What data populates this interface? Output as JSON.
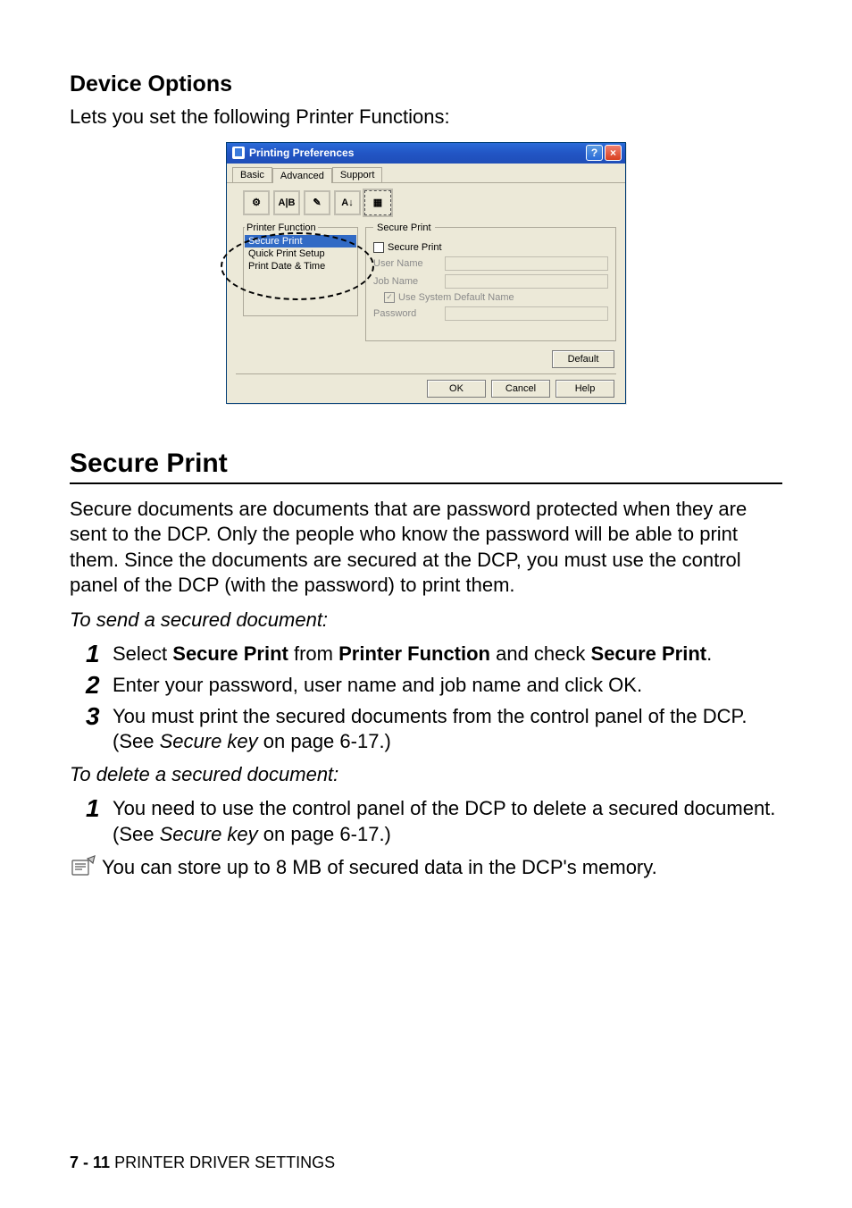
{
  "headings": {
    "device_options": "Device Options",
    "secure_print": "Secure Print"
  },
  "intro_text": "Lets you set the following Printer Functions:",
  "dialog": {
    "title": "Printing Preferences",
    "help_glyph": "?",
    "close_glyph": "×",
    "tabs": {
      "basic": "Basic",
      "advanced": "Advanced",
      "support": "Support"
    },
    "toolbar_icons": {
      "opt1": "⚙",
      "opt2": "A|B",
      "opt3": "✎",
      "opt4": "A↓",
      "opt5": "▦"
    },
    "printer_function_label": "Printer Function",
    "printer_functions": {
      "secure_print": "Secure Print",
      "quick_print_setup": "Quick Print Setup",
      "print_date_time": "Print Date & Time"
    },
    "secure_group_label": "Secure Print",
    "secure_print_checkbox": "Secure Print",
    "user_name_label": "User Name",
    "job_name_label": "Job Name",
    "use_system_default": "Use System Default Name",
    "password_label": "Password",
    "check_glyph": "✓",
    "buttons": {
      "default": "Default",
      "ok": "OK",
      "cancel": "Cancel",
      "help": "Help"
    }
  },
  "secure_para": "Secure documents are documents that are password protected when they are sent to the DCP. Only the people who know the password will be able to print them. Since the documents are secured at the DCP, you must use the control panel of the DCP (with the password) to print them.",
  "to_send": "To send a secured document:",
  "steps_send": {
    "s1_pre": "Select ",
    "s1_b1": "Secure Print",
    "s1_mid": " from ",
    "s1_b2": "Printer Function",
    "s1_mid2": " and check ",
    "s1_b3": "Secure Print",
    "s1_end": ".",
    "s2": "Enter your password, user name and job name and click OK.",
    "s3_pre": "You must print the secured documents from the control panel of the DCP. (See ",
    "s3_ital": "Secure key",
    "s3_end": " on page 6-17.)"
  },
  "to_delete": "To delete a secured document:",
  "steps_delete": {
    "d1_pre": "You need to use the control panel of the DCP to delete a secured document. (See ",
    "d1_ital": "Secure key",
    "d1_end": " on page 6-17.)"
  },
  "note_text": "You can store up to 8 MB of secured data in the DCP's memory.",
  "nums": {
    "n1": "1",
    "n2": "2",
    "n3": "3"
  },
  "footer": {
    "page": "7 - 11",
    "section": "PRINTER DRIVER SETTINGS",
    "sep": "   "
  }
}
